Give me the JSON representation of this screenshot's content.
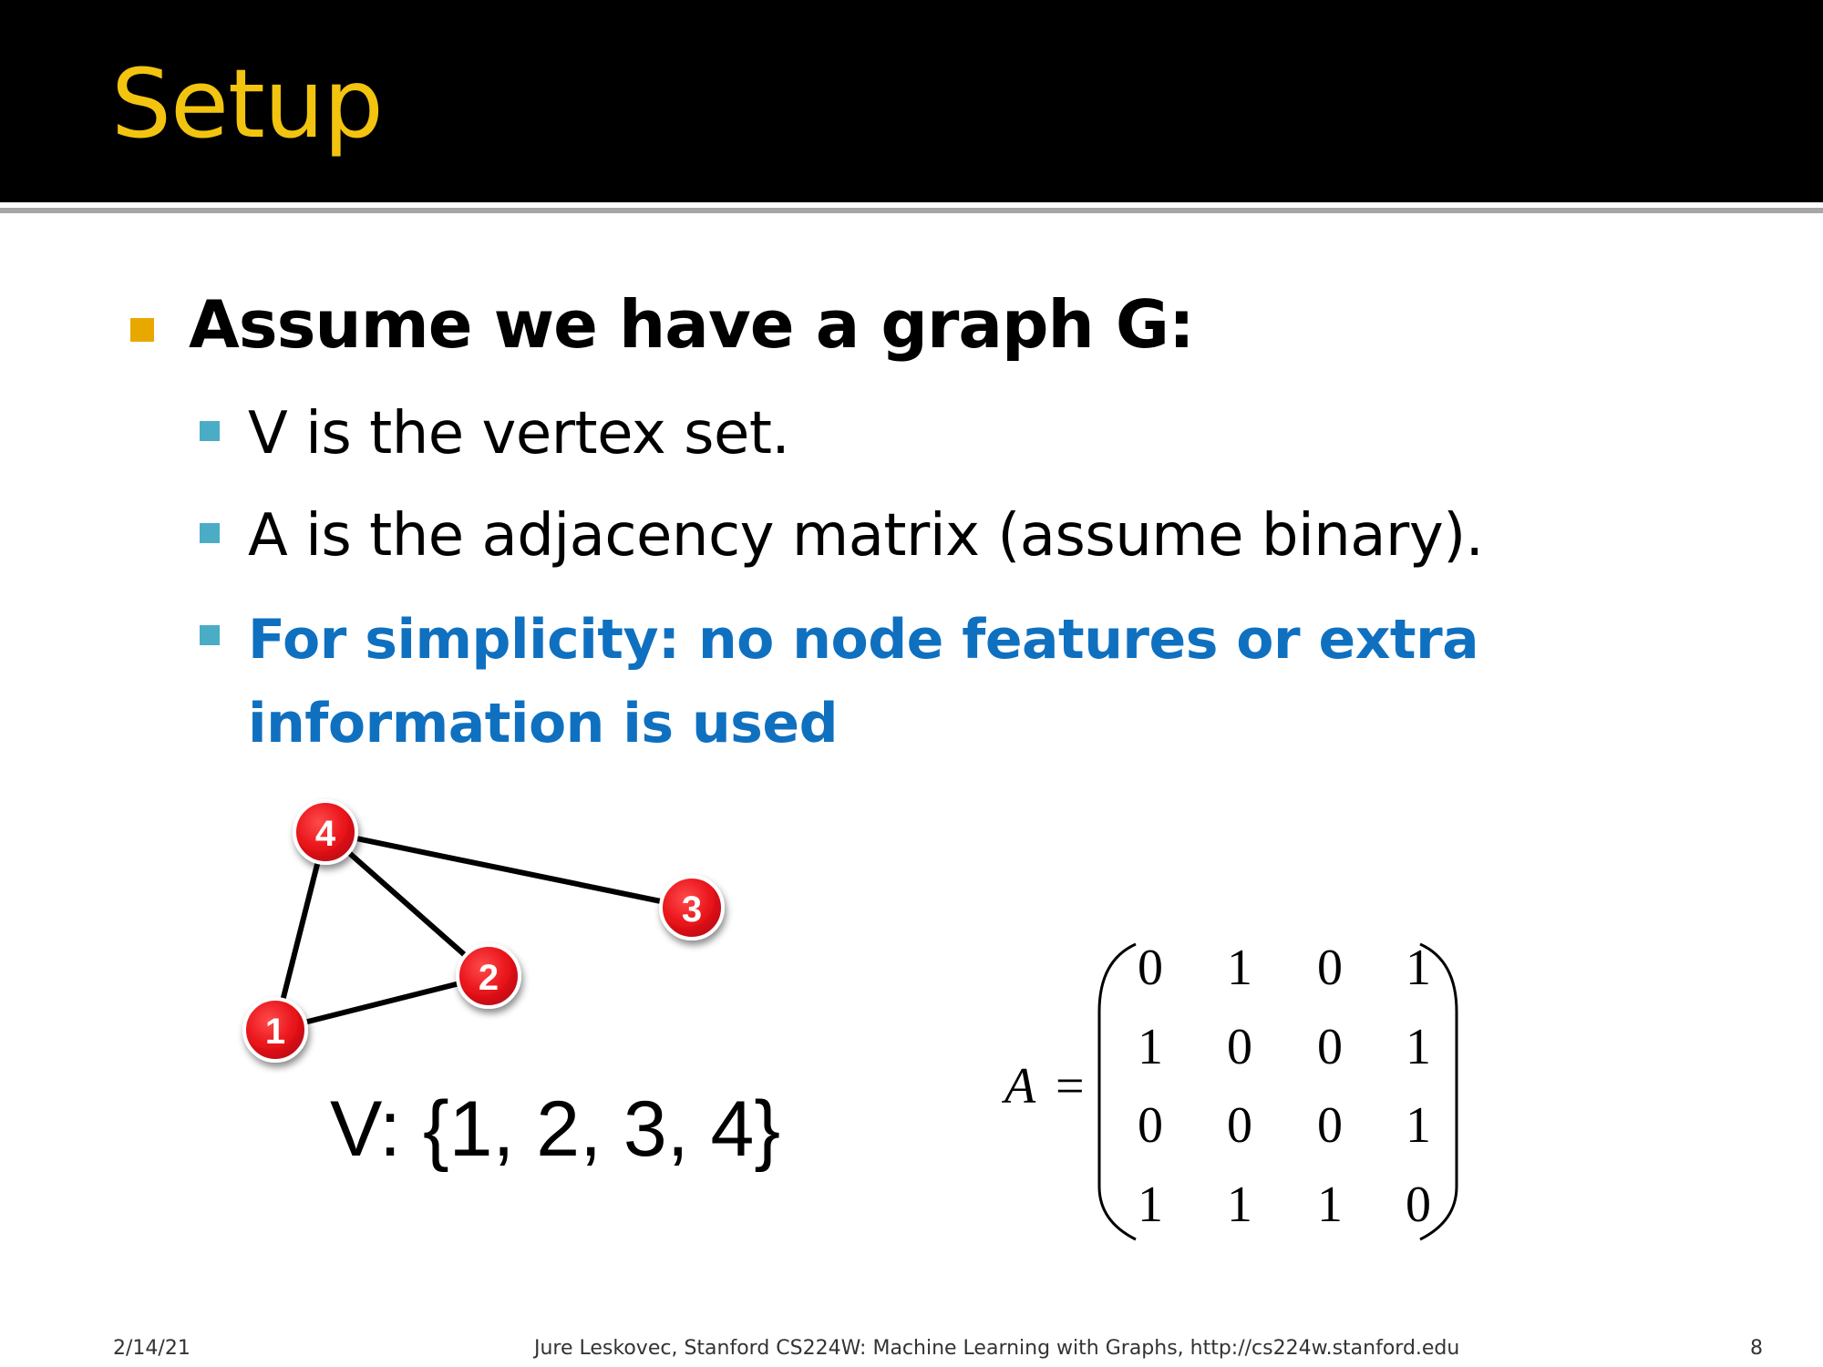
{
  "slide": {
    "title": "Setup",
    "bullets": {
      "main": "Assume we have a graph G:",
      "sub1": "V is the vertex set.",
      "sub2": "A is the adjacency matrix (assume binary).",
      "sub3_line1": "For simplicity: no node features or extra",
      "sub3_line2": "information is used"
    },
    "vertex_set": "V: {1, 2, 3, 4}"
  },
  "graph": {
    "nodes": [
      "1",
      "2",
      "3",
      "4"
    ],
    "edges": [
      [
        "4",
        "1"
      ],
      [
        "4",
        "2"
      ],
      [
        "4",
        "3"
      ],
      [
        "1",
        "2"
      ]
    ],
    "node_color": "#e8131a"
  },
  "matrix": {
    "label": "A",
    "equals": "=",
    "rows": [
      [
        "0",
        "1",
        "0",
        "1"
      ],
      [
        "1",
        "0",
        "0",
        "1"
      ],
      [
        "0",
        "0",
        "0",
        "1"
      ],
      [
        "1",
        "1",
        "1",
        "0"
      ]
    ]
  },
  "footer": {
    "date": "2/14/21",
    "credit": "Jure Leskovec, Stanford CS224W: Machine Learning with Graphs, http://cs224w.stanford.edu",
    "page": "8"
  },
  "colors": {
    "title": "#f2c40f",
    "bullet_l1": "#e8a800",
    "bullet_l2": "#4bacc6",
    "accent_text": "#0f70c0"
  }
}
